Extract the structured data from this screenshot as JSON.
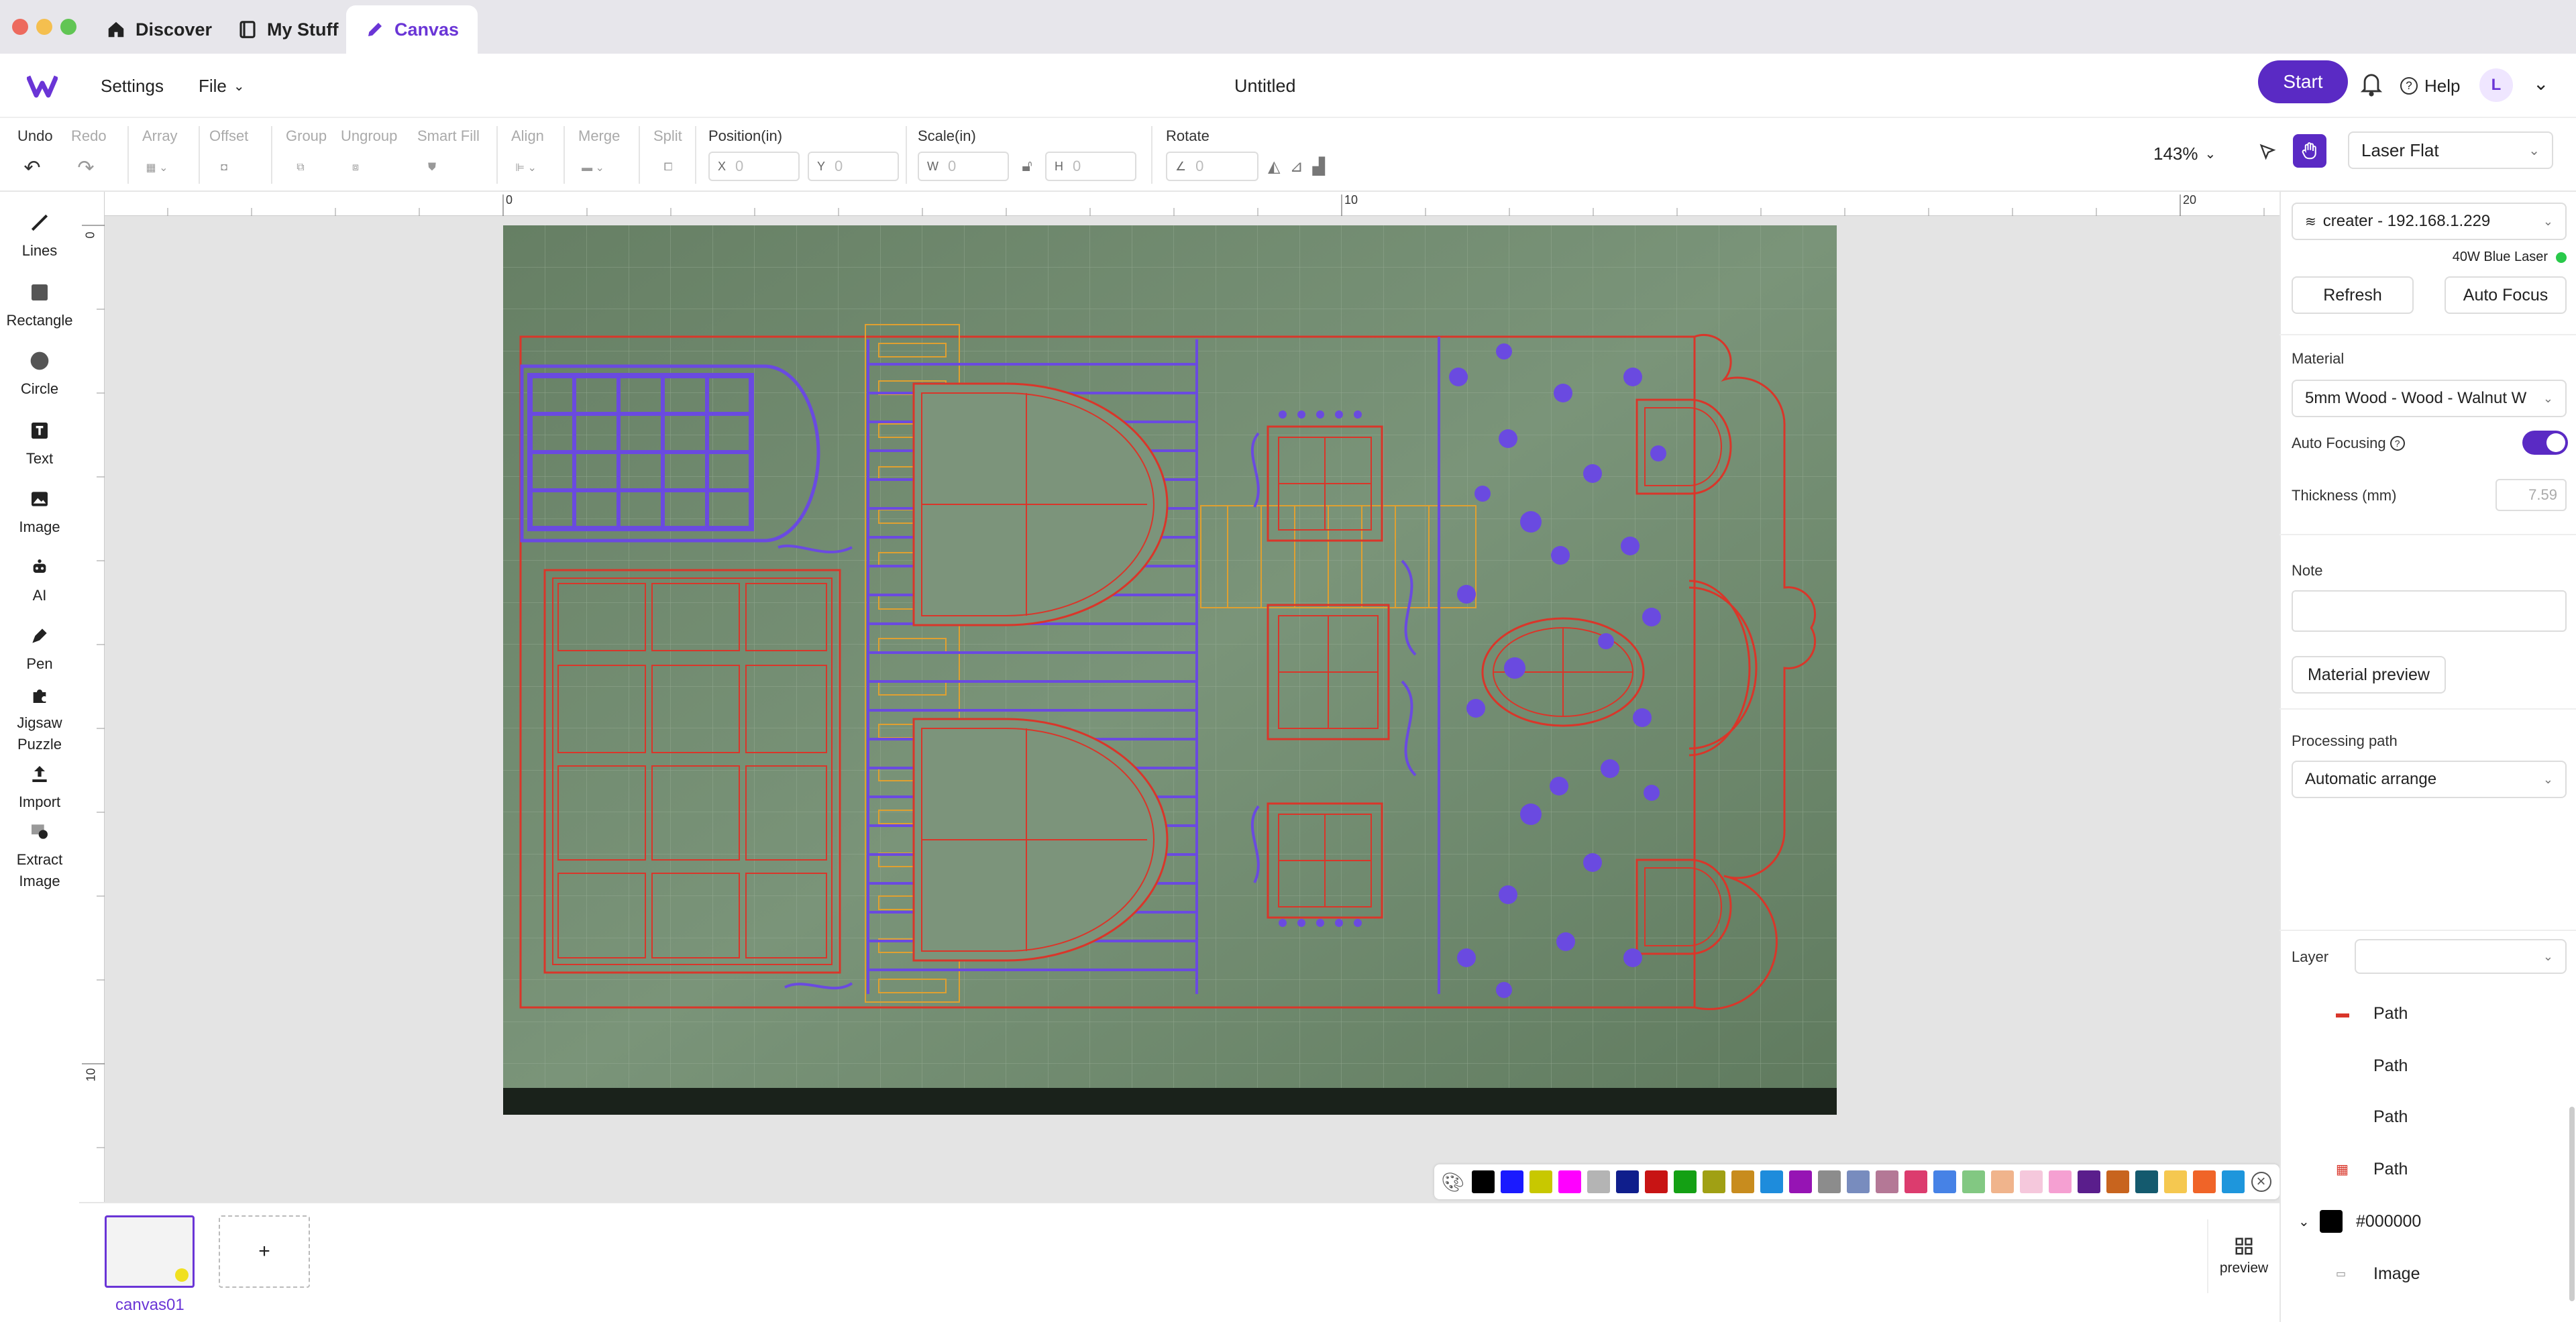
{
  "tabs": [
    {
      "label": "Discover",
      "icon": "home-icon"
    },
    {
      "label": "My Stuff",
      "icon": "book-icon"
    },
    {
      "label": "Canvas",
      "icon": "pencil-icon"
    }
  ],
  "header": {
    "settings": "Settings",
    "file": "File",
    "doc_title": "Untitled",
    "start": "Start",
    "help": "Help",
    "avatar": "L"
  },
  "toolbar": {
    "undo": "Undo",
    "redo": "Redo",
    "array": "Array",
    "offset": "Offset",
    "group": "Group",
    "ungroup": "Ungroup",
    "smart_fill": "Smart Fill",
    "align": "Align",
    "merge": "Merge",
    "split": "Split",
    "position_label": "Position(in)",
    "scale_label": "Scale(in)",
    "rotate_label": "Rotate",
    "x_axis": "X",
    "y_axis": "Y",
    "w_axis": "W",
    "h_axis": "H",
    "x_val": "0",
    "y_val": "0",
    "w_val": "0",
    "h_val": "0",
    "rot_val": "0",
    "zoom": "143%",
    "device_mode": "Laser Flat"
  },
  "tools": [
    {
      "label": "Lines"
    },
    {
      "label": "Rectangle"
    },
    {
      "label": "Circle"
    },
    {
      "label": "Text"
    },
    {
      "label": "Image"
    },
    {
      "label": "AI"
    },
    {
      "label": "Pen"
    },
    {
      "label": "Jigsaw Puzzle"
    },
    {
      "label": "Import"
    },
    {
      "label": "Extract Image"
    }
  ],
  "ruler": {
    "top": [
      "0",
      "10",
      "20"
    ],
    "left": [
      "0",
      "10"
    ]
  },
  "palette": [
    "#000000",
    "#1a1aff",
    "#c8c800",
    "#ff00ff",
    "#b4b4b4",
    "#0f1e8c",
    "#c81414",
    "#14a014",
    "#a0a014",
    "#c88c1e",
    "#1e8cdc",
    "#9614b4",
    "#8c8c8c",
    "#788cbe",
    "#b47896",
    "#dc3c6e",
    "#4682e6",
    "#82c882",
    "#f0b48c",
    "#f5c8dc",
    "#f5a0d2",
    "#5a1e8c",
    "#c8641e",
    "#145a6e",
    "#f5c850",
    "#f06428",
    "#1e96dc"
  ],
  "canvas_tab": "canvas01",
  "preview": "preview",
  "right": {
    "device": "creater - 192.168.1.229",
    "laser": "40W Blue Laser",
    "refresh": "Refresh",
    "auto_focus": "Auto Focus",
    "material_label": "Material",
    "material": "5mm Wood - Wood - Walnut W",
    "auto_focusing": "Auto Focusing",
    "thickness_label": "Thickness  (mm)",
    "thickness": "7.59",
    "note_label": "Note",
    "material_preview": "Material preview",
    "processing_label": "Processing path",
    "processing": "Automatic arrange",
    "layer_label": "Layer",
    "layers": [
      "Path",
      "Path",
      "Path",
      "Path"
    ],
    "color_group": "#000000",
    "image_layer": "Image"
  }
}
